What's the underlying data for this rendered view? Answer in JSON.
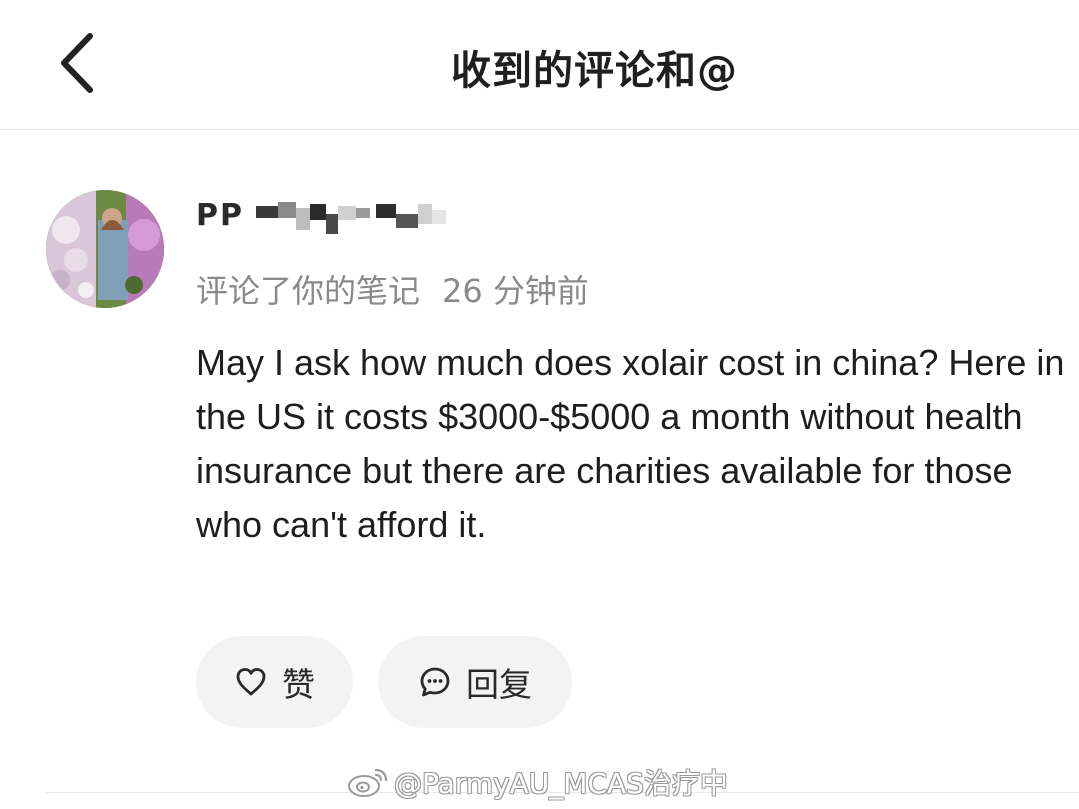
{
  "header": {
    "title": "收到的评论和@",
    "back_icon": "chevron-left-icon"
  },
  "comment": {
    "username": "PP",
    "action": "评论了你的笔记",
    "time": "26 分钟前",
    "text": "May I ask how much does xolair cost in china? Here in the US it costs $3000-$5000 a month without health insurance but there are charities available for those who can't afford it.",
    "like_label": "赞",
    "reply_label": "回复",
    "like_icon": "heart-outline-icon",
    "reply_icon": "chat-bubble-icon"
  },
  "watermark": {
    "text": "@ParmyAU_MCAS治疗中",
    "icon": "weibo-logo-icon"
  }
}
